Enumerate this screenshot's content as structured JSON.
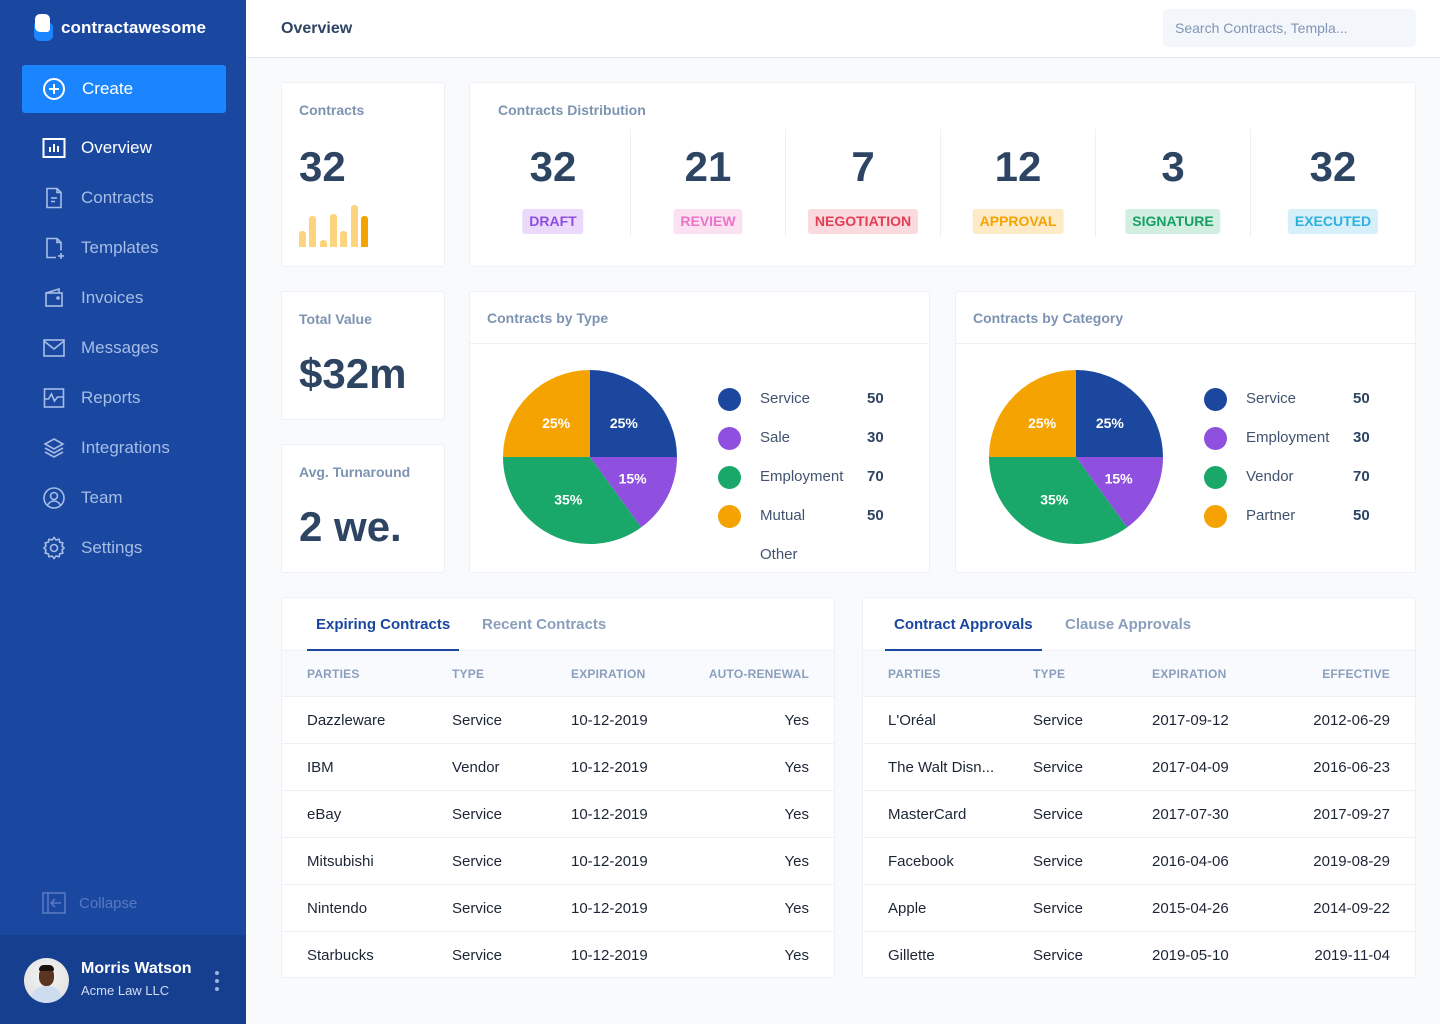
{
  "app": {
    "name": "contractawesome"
  },
  "sidebar": {
    "create_label": "Create",
    "items": [
      {
        "label": "Overview",
        "icon": "bar-chart-icon",
        "active": true
      },
      {
        "label": "Contracts",
        "icon": "document-icon"
      },
      {
        "label": "Templates",
        "icon": "document-plus-icon"
      },
      {
        "label": "Invoices",
        "icon": "wallet-icon"
      },
      {
        "label": "Messages",
        "icon": "envelope-icon"
      },
      {
        "label": "Reports",
        "icon": "activity-chart-icon"
      },
      {
        "label": "Integrations",
        "icon": "layers-icon"
      },
      {
        "label": "Team",
        "icon": "user-circle-icon"
      },
      {
        "label": "Settings",
        "icon": "gear-icon"
      }
    ],
    "collapse_label": "Collapse",
    "user": {
      "name": "Morris Watson",
      "org": "Acme Law LLC"
    }
  },
  "header": {
    "title": "Overview",
    "search_placeholder": "Search Contracts, Templa..."
  },
  "stats": {
    "contracts": {
      "label": "Contracts",
      "value": "32",
      "trend": [
        16,
        31,
        7,
        33,
        16,
        42,
        31
      ]
    },
    "total_value": {
      "label": "Total Value",
      "value": "$32m"
    },
    "avg_turnaround": {
      "label": "Avg. Turnaround",
      "value": "2 we."
    }
  },
  "distribution": {
    "label": "Contracts Distribution",
    "items": [
      {
        "value": "32",
        "status": "DRAFT",
        "color": "#8e4fe0",
        "bg": "#ead9fa"
      },
      {
        "value": "21",
        "status": "REVIEW",
        "color": "#eb74c8",
        "bg": "#fbe1f2"
      },
      {
        "value": "7",
        "status": "NEGOTIATION",
        "color": "#e23f56",
        "bg": "#fbdadf"
      },
      {
        "value": "12",
        "status": "APPROVAL",
        "color": "#f5a300",
        "bg": "#fdebc8"
      },
      {
        "value": "3",
        "status": "SIGNATURE",
        "color": "#16a064",
        "bg": "#d1eee1"
      },
      {
        "value": "32",
        "status": "EXECUTED",
        "color": "#2db2de",
        "bg": "#d6eff9"
      }
    ]
  },
  "chart_data": [
    {
      "type": "pie",
      "title": "Contracts by Type",
      "slices": [
        {
          "label": "Service",
          "percent": 25,
          "value": 50,
          "color": "#1c479f"
        },
        {
          "label": "Sale",
          "percent": 15,
          "value": 30,
          "color": "#8f50e0"
        },
        {
          "label": "Employment",
          "percent": 35,
          "value": 70,
          "color": "#19a86a"
        },
        {
          "label": "Mutual",
          "percent": 25,
          "value": 50,
          "color": "#f5a300"
        }
      ],
      "legend": [
        {
          "label": "Service",
          "value": "50",
          "color": "#1c479f"
        },
        {
          "label": "Sale",
          "value": "30",
          "color": "#8f50e0"
        },
        {
          "label": "Employment",
          "value": "70",
          "color": "#19a86a"
        },
        {
          "label": "Mutual",
          "value": "50",
          "color": "#f5a300"
        },
        {
          "label": "Other",
          "value": "",
          "color": ""
        }
      ],
      "legend_position": "right"
    },
    {
      "type": "pie",
      "title": "Contracts by Category",
      "slices": [
        {
          "label": "Service",
          "percent": 25,
          "value": 50,
          "color": "#1c479f"
        },
        {
          "label": "Employment",
          "percent": 15,
          "value": 30,
          "color": "#8f50e0"
        },
        {
          "label": "Vendor",
          "percent": 35,
          "value": 70,
          "color": "#19a86a"
        },
        {
          "label": "Partner",
          "percent": 25,
          "value": 50,
          "color": "#f5a300"
        }
      ],
      "legend": [
        {
          "label": "Service",
          "value": "50",
          "color": "#1c479f"
        },
        {
          "label": "Employment",
          "value": "30",
          "color": "#8f50e0"
        },
        {
          "label": "Vendor",
          "value": "70",
          "color": "#19a86a"
        },
        {
          "label": "Partner",
          "value": "50",
          "color": "#f5a300"
        }
      ],
      "legend_position": "right"
    }
  ],
  "tables": [
    {
      "tabs": [
        "Expiring Contracts",
        "Recent Contracts"
      ],
      "active_tab": 0,
      "columns": [
        "PARTIES",
        "TYPE",
        "EXPIRATION",
        "AUTO-RENEWAL"
      ],
      "rows": [
        [
          "Dazzleware",
          "Service",
          "10-12-2019",
          "Yes"
        ],
        [
          "IBM",
          "Vendor",
          "10-12-2019",
          "Yes"
        ],
        [
          "eBay",
          "Service",
          "10-12-2019",
          "Yes"
        ],
        [
          "Mitsubishi",
          "Service",
          "10-12-2019",
          "Yes"
        ],
        [
          "Nintendo",
          "Service",
          "10-12-2019",
          "Yes"
        ],
        [
          "Starbucks",
          "Service",
          "10-12-2019",
          "Yes"
        ]
      ]
    },
    {
      "tabs": [
        "Contract Approvals",
        "Clause Approvals"
      ],
      "active_tab": 0,
      "columns": [
        "PARTIES",
        "TYPE",
        "EXPIRATION",
        "EFFECTIVE"
      ],
      "rows": [
        [
          "L'Oréal",
          "Service",
          "2017-09-12",
          "2012-06-29"
        ],
        [
          "The Walt Disn...",
          "Service",
          "2017-04-09",
          "2016-06-23"
        ],
        [
          "MasterCard",
          "Service",
          "2017-07-30",
          "2017-09-27"
        ],
        [
          "Facebook",
          "Service",
          "2016-04-06",
          "2019-08-29"
        ],
        [
          "Apple",
          "Service",
          "2015-04-26",
          "2014-09-22"
        ],
        [
          "Gillette",
          "Service",
          "2019-05-10",
          "2019-11-04"
        ]
      ]
    }
  ]
}
